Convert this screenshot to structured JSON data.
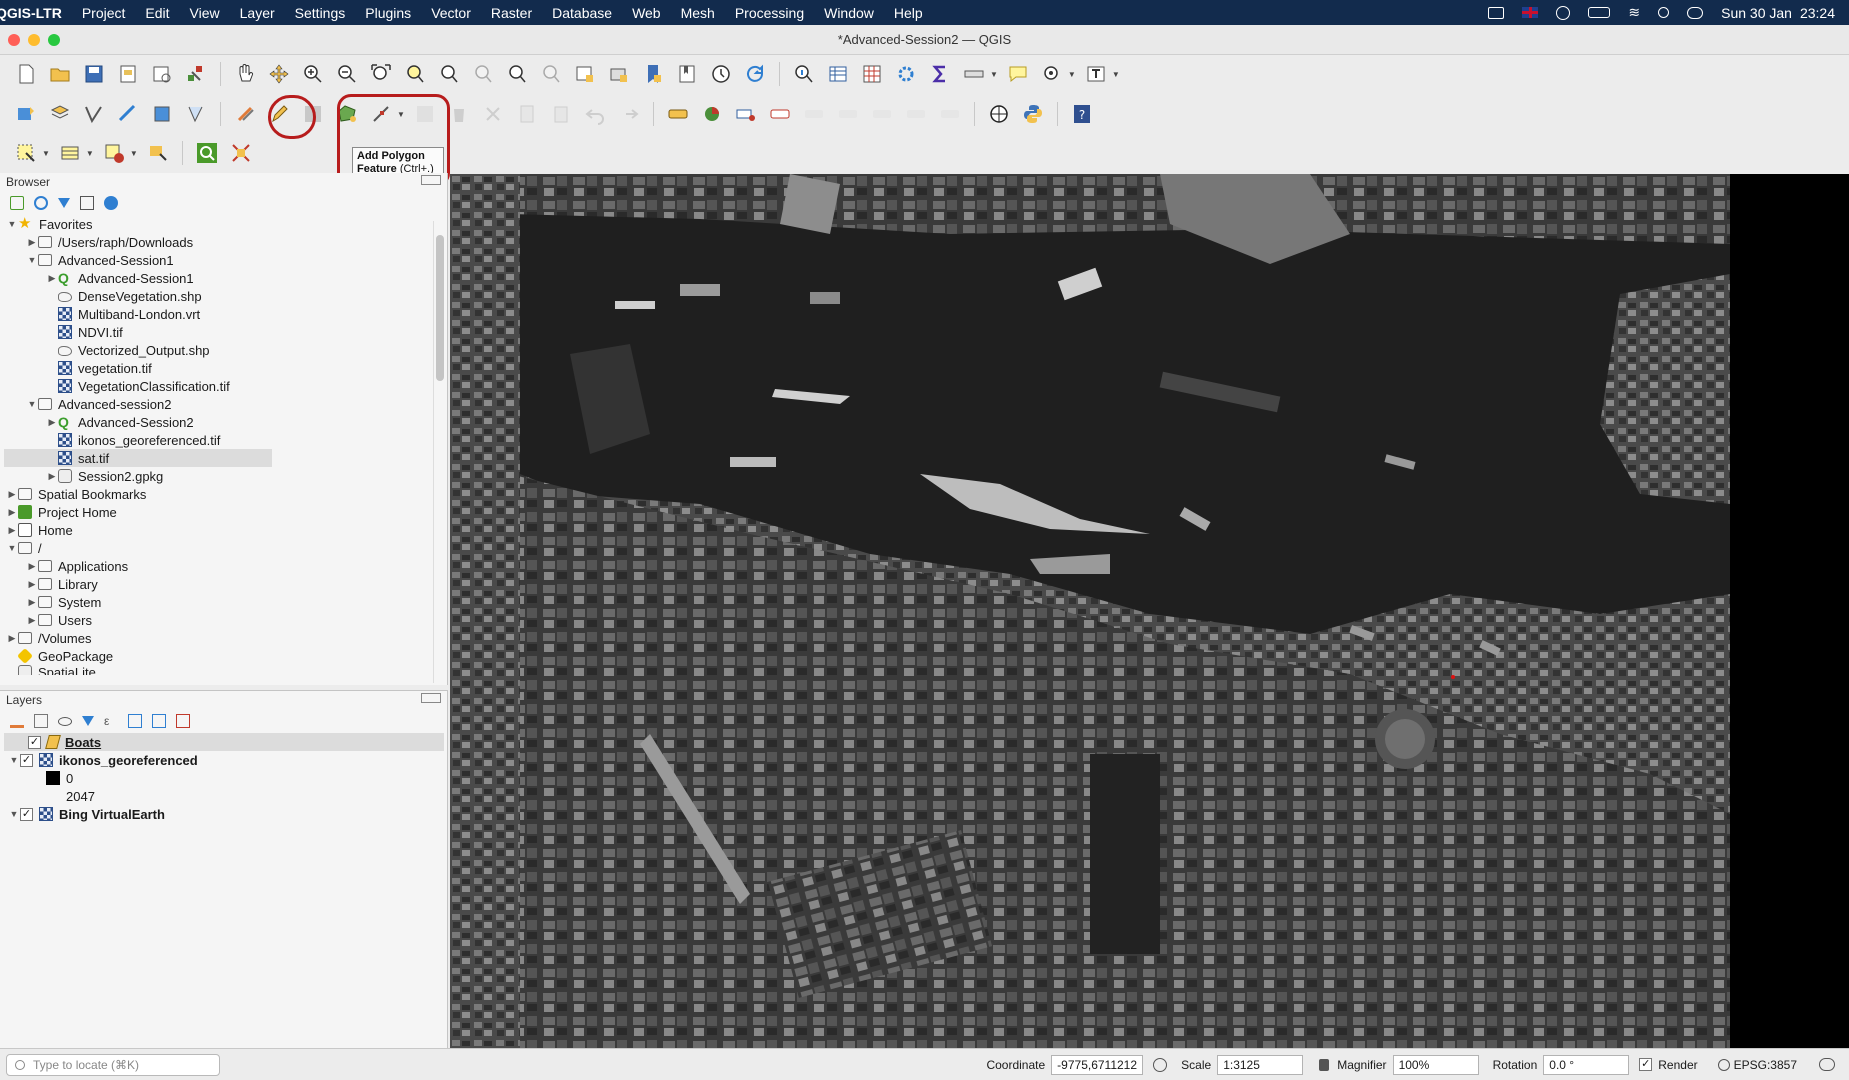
{
  "menubar": {
    "app": "QGIS-LTR",
    "items": [
      "Project",
      "Edit",
      "View",
      "Layer",
      "Settings",
      "Plugins",
      "Vector",
      "Raster",
      "Database",
      "Web",
      "Mesh",
      "Processing",
      "Window",
      "Help"
    ],
    "date": "Sun 30 Jan",
    "time": "23:24"
  },
  "window": {
    "title": "*Advanced-Session2 — QGIS"
  },
  "tooltip": {
    "title": "Add Polygon Feature",
    "shortcut": "(Ctrl+.)"
  },
  "browser": {
    "title": "Browser",
    "items": [
      "Favorites",
      "/Users/raph/Downloads",
      "Advanced-Session1",
      "Advanced-Session1",
      "DenseVegetation.shp",
      "Multiband-London.vrt",
      "NDVI.tif",
      "Vectorized_Output.shp",
      "vegetation.tif",
      "VegetationClassification.tif",
      "Advanced-session2",
      "Advanced-Session2",
      "ikonos_georeferenced.tif",
      "sat.tif",
      "Session2.gpkg",
      "Spatial Bookmarks",
      "Project Home",
      "Home",
      "/",
      "Applications",
      "Library",
      "System",
      "Users",
      "/Volumes",
      "GeoPackage",
      "SpatiaLite"
    ]
  },
  "layers": {
    "title": "Layers",
    "items": [
      "Boats",
      "ikonos_georeferenced",
      "0",
      "2047",
      "Bing VirtualEarth"
    ]
  },
  "status": {
    "locate_placeholder": "Type to locate (⌘K)",
    "coordinate_label": "Coordinate",
    "coordinate": "-9775,6711212",
    "scale_label": "Scale",
    "scale": "1:3125",
    "magnifier_label": "Magnifier",
    "magnifier": "100%",
    "rotation_label": "Rotation",
    "rotation": "0.0 °",
    "render_label": "Render",
    "crs": "EPSG:3857"
  },
  "colors": {
    "menubar": "#122b4d",
    "highlight": "#b71c1c",
    "accent_green": "#3b9d2c"
  }
}
